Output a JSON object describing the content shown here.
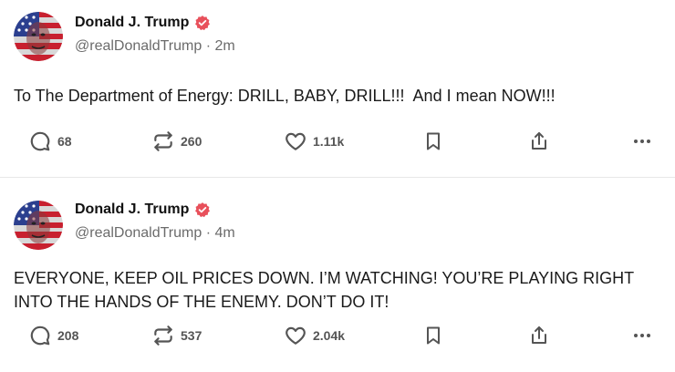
{
  "posts": [
    {
      "author": "Donald J. Trump",
      "handle": "@realDonaldTrump · 2m",
      "text": "To The Department of Energy: DRILL, BABY, DRILL!!!  And I mean NOW!!!",
      "replies": "68",
      "reposts": "260",
      "likes": "1.11k"
    },
    {
      "author": "Donald J. Trump",
      "handle": "@realDonaldTrump · 4m",
      "text": "EVERYONE, KEEP OIL PRICES DOWN. I’M WATCHING! YOU’RE PLAYING RIGHT INTO THE HANDS OF THE ENEMY. DON’T DO IT!",
      "replies": "208",
      "reposts": "537",
      "likes": "2.04k"
    }
  ],
  "colors": {
    "verified": "#e8505b",
    "icon": "#555555",
    "divider": "#e8e8e8"
  },
  "icons": [
    "verified-badge-icon",
    "reply-icon",
    "repost-icon",
    "like-icon",
    "bookmark-icon",
    "share-icon",
    "more-icon"
  ]
}
